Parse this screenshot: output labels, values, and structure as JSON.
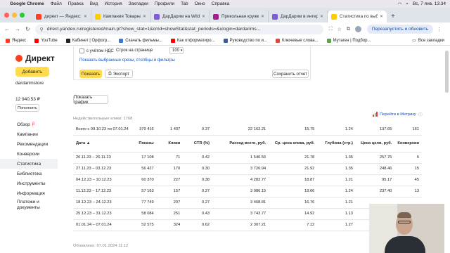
{
  "menubar": {
    "app": "Google Chrome",
    "items": [
      "Файл",
      "Правка",
      "Вид",
      "История",
      "Закладки",
      "Профили",
      "Tab",
      "Окно",
      "Справка"
    ],
    "datetime": "Вс, 7 янв. 13:34"
  },
  "tabs": [
    {
      "title": "директ — Яндекс: нашлось",
      "color": "#fc3f1d"
    },
    {
      "title": "Кампания Товарная (",
      "color": "#ffcc00"
    },
    {
      "title": "ДарДарим на Wildberries",
      "color": "#7b5cd6"
    },
    {
      "title": "Прикольная кружка | ",
      "color": "#a01e8a"
    },
    {
      "title": "ДарДарим в интернет",
      "color": "#7b5cd6"
    },
    {
      "title": "Статистика по выбр",
      "color": "#ffcc00",
      "active": true
    }
  ],
  "address": {
    "url": "direct.yandex.ru/registered/main.pl?show_stat=1&cmd=showStat&stat_periods=&ulogin=dardarims...",
    "restart_label": "Перезапустить и обновить"
  },
  "bookmarks": [
    {
      "label": "Яндекс",
      "color": "#fc3f1d"
    },
    {
      "label": "YouTube",
      "color": "#ff0000"
    },
    {
      "label": "Кабинет | Орфогр...",
      "color": "#222222"
    },
    {
      "label": "Скачать фильмы...",
      "color": "#3a7bd5"
    },
    {
      "label": "Как отформатиро...",
      "color": "#ff0000"
    },
    {
      "label": "Руководство по и...",
      "color": "#3d5a99"
    },
    {
      "label": "Ключевые слова...",
      "color": "#e0463c"
    },
    {
      "label": "Мутаген | Подбор...",
      "color": "#5ea14a"
    }
  ],
  "bookmarks_all": "Все закладки",
  "sidebar": {
    "logo": "Директ",
    "add_label": "Добавить",
    "login": "dardarimstore",
    "balance": "12 940,53 ₽",
    "topup_label": "Пополнить",
    "items": [
      {
        "label": "Обзор",
        "badge": "β"
      },
      {
        "label": "Кампании"
      },
      {
        "label": "Рекомендации"
      },
      {
        "label": "Конверсии"
      },
      {
        "label": "Статистика",
        "active": true
      },
      {
        "label": "Библиотека"
      },
      {
        "label": "Инструменты"
      },
      {
        "label": "Информация"
      },
      {
        "label": "Платежи и документы"
      }
    ]
  },
  "filters": {
    "vat_label": "с учётом НДС",
    "rows_label": "Строк на странице",
    "rows_value": "100",
    "show_filters_link": "Показать выбранные срезы, столбцы и фильтры",
    "show_label": "Показать",
    "export_label": "Экспорт",
    "save_label": "Сохранить отчет"
  },
  "chart_button": "Показать график",
  "invalid_clicks": "Недействительные клики: 1768",
  "metrika_link": "Перейти в Метрику",
  "table": {
    "total": [
      "Всего с 09.10.23 по 07.01.24",
      "379 416",
      "1 407",
      "0.37",
      "22 162.21",
      "15.75",
      "1.24",
      "137.65",
      "161"
    ],
    "headers": [
      "Дата ▲",
      "Показы",
      "Клики",
      "CTR (%)",
      "Расход всего, руб.",
      "Ср. цена клика, руб.",
      "Глубина (стр.)",
      "Цена цели, руб.",
      "Конверсии"
    ],
    "rows": [
      [
        "20.11.23 – 26.11.23",
        "17 108",
        "71",
        "0.42",
        "1 546.56",
        "21.78",
        "1.35",
        "257.76",
        "6"
      ],
      [
        "27.11.23 – 03.12.23",
        "56 427",
        "170",
        "0.30",
        "3 726.94",
        "21.92",
        "1.35",
        "248.46",
        "15"
      ],
      [
        "04.12.23 – 10.12.23",
        "60 370",
        "227",
        "0.38",
        "4 282.77",
        "18.87",
        "1.21",
        "95.17",
        "45"
      ],
      [
        "11.12.23 – 17.12.23",
        "57 163",
        "157",
        "0.27",
        "3 086.15",
        "19.66",
        "1.24",
        "237.40",
        "13"
      ],
      [
        "18.12.23 – 24.12.23",
        "77 749",
        "207",
        "0.27",
        "3 468.81",
        "16.76",
        "1.21",
        "",
        ""
      ],
      [
        "25.12.23 – 31.12.23",
        "58 084",
        "251",
        "0.43",
        "3 743.77",
        "14.92",
        "1.13",
        "",
        ""
      ],
      [
        "01.01.24 – 07.01.24",
        "52 575",
        "324",
        "0.62",
        "2 307.21",
        "7.12",
        "1.27",
        "",
        ""
      ]
    ]
  },
  "updated": "Обновлено: 07.01.2024 11:12"
}
